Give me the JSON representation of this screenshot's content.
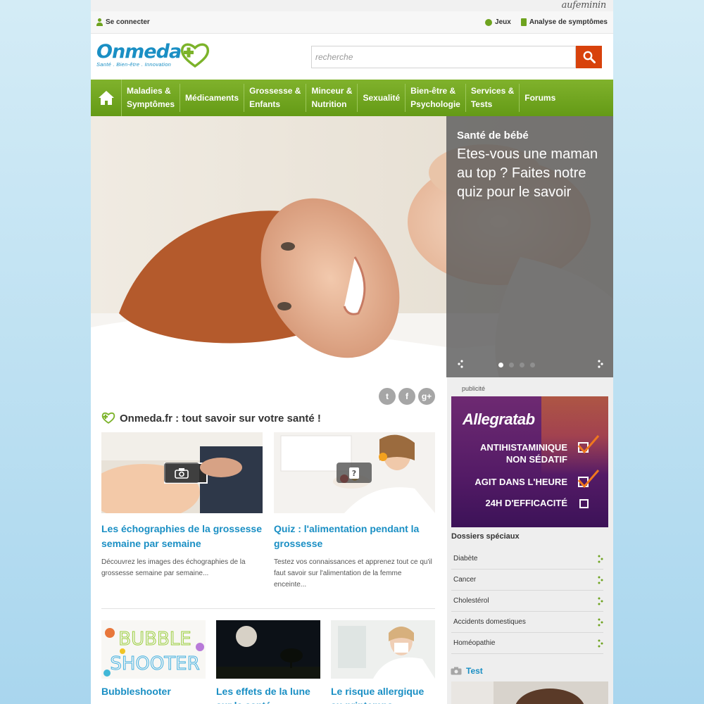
{
  "partner": {
    "name": "aufeminin"
  },
  "util": {
    "login": "Se connecter",
    "games": "Jeux",
    "symptoms": "Analyse de symptômes",
    "user_icon": "user-icon",
    "games_icon": "games-icon",
    "symptom_icon": "symptom-check-icon"
  },
  "logo": {
    "name": "Onmeda",
    "tagline": "Santé . Bien-être . Innovation"
  },
  "search": {
    "placeholder": "recherche",
    "value": ""
  },
  "nav": {
    "home_icon": "home-icon",
    "items": [
      {
        "l1": "Maladies &",
        "l2": "Symptômes"
      },
      {
        "l1": "Médicaments",
        "l2": ""
      },
      {
        "l1": "Grossesse &",
        "l2": "Enfants"
      },
      {
        "l1": "Minceur &",
        "l2": "Nutrition"
      },
      {
        "l1": "Sexualité",
        "l2": ""
      },
      {
        "l1": "Bien-être &",
        "l2": "Psychologie"
      },
      {
        "l1": "Services &",
        "l2": "Tests"
      },
      {
        "l1": "Forums",
        "l2": ""
      }
    ]
  },
  "hero": {
    "category": "Santé de bébé",
    "title": "Etes-vous une maman au top ? Faites notre quiz pour le savoir",
    "slides_total": 4,
    "active_slide": 1
  },
  "main": {
    "social": [
      "t",
      "f",
      "g+"
    ],
    "section_title": "Onmeda.fr : tout savoir sur votre santé !",
    "cards": [
      {
        "title": "Les échographies de la grossesse semaine par semaine",
        "desc": "Découvrez les images des échographies de la grossesse semaine par semaine...",
        "badge_icon": "camera-icon"
      },
      {
        "title": "Quiz : l'alimentation pendant la grossesse",
        "desc": "Testez vos connaissances et apprenez tout ce qu'il faut savoir sur l'alimentation de la femme enceinte...",
        "badge_icon": "quiz-icon"
      }
    ],
    "small_cards": [
      {
        "title": "Bubbleshooter",
        "img_text_1": "BUBBLE",
        "img_text_2": "SHOOTER"
      },
      {
        "title": "Les effets de la lune sur la santé"
      },
      {
        "title": "Le risque allergique au printemps"
      }
    ]
  },
  "sidebar": {
    "ad_label": "publicité",
    "ad": {
      "brand": "Allegratab",
      "line1a": "ANTIHISTAMINIQUE",
      "line1b": "NON SÉDATIF",
      "line2": "AGIT DANS L'HEURE",
      "line3": "24H D'EFFICACITÉ"
    },
    "dossiers_title": "Dossiers spéciaux",
    "dossiers": [
      "Diabète",
      "Cancer",
      "Cholestérol",
      "Accidents domestiques",
      "Homéopathie"
    ],
    "test_title": "Test",
    "test_icon": "camera-icon"
  },
  "colors": {
    "green": "#6ea31f",
    "blue": "#1a8fc4",
    "orange": "#d8420c"
  }
}
